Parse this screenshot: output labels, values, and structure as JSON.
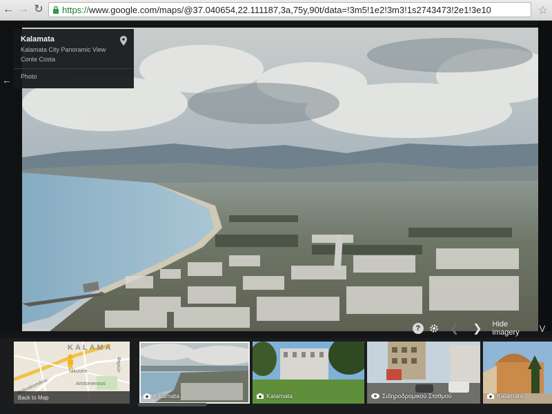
{
  "browser": {
    "url_scheme": "https://",
    "url_host": "www.google.com",
    "url_path": "/maps/@37.040654,22.111187,3a,75y,90t/data=!3m5!1e2!3m3!1s2743473!2e1!3e10"
  },
  "info_card": {
    "title": "Kalamata",
    "subtitle": "Kalamata City Panoramic View",
    "author": "Conte Costa",
    "type": "Photo"
  },
  "controls": {
    "help": "?",
    "hide_imagery": "Hide imagery"
  },
  "filmstrip": {
    "map_back_label": "Back to Map",
    "map_texts": [
      "KALAMA",
      "Nikotara",
      "Φαρών",
      "Aristomenous",
      "Sidirodromikou"
    ],
    "thumbs": [
      {
        "label": "Kalamata",
        "icon": "camera-icon"
      },
      {
        "label": "Kalamata",
        "icon": "camera-icon"
      },
      {
        "label": "Σιδηροδρομικού Σταθμού",
        "icon": "street-view-icon"
      },
      {
        "label": "Kalamata",
        "icon": "camera-icon"
      }
    ]
  },
  "colors": {
    "url_scheme_green": "#1a7f2e",
    "panel_dark": "#16171a",
    "sea": "#8fb3c6"
  }
}
